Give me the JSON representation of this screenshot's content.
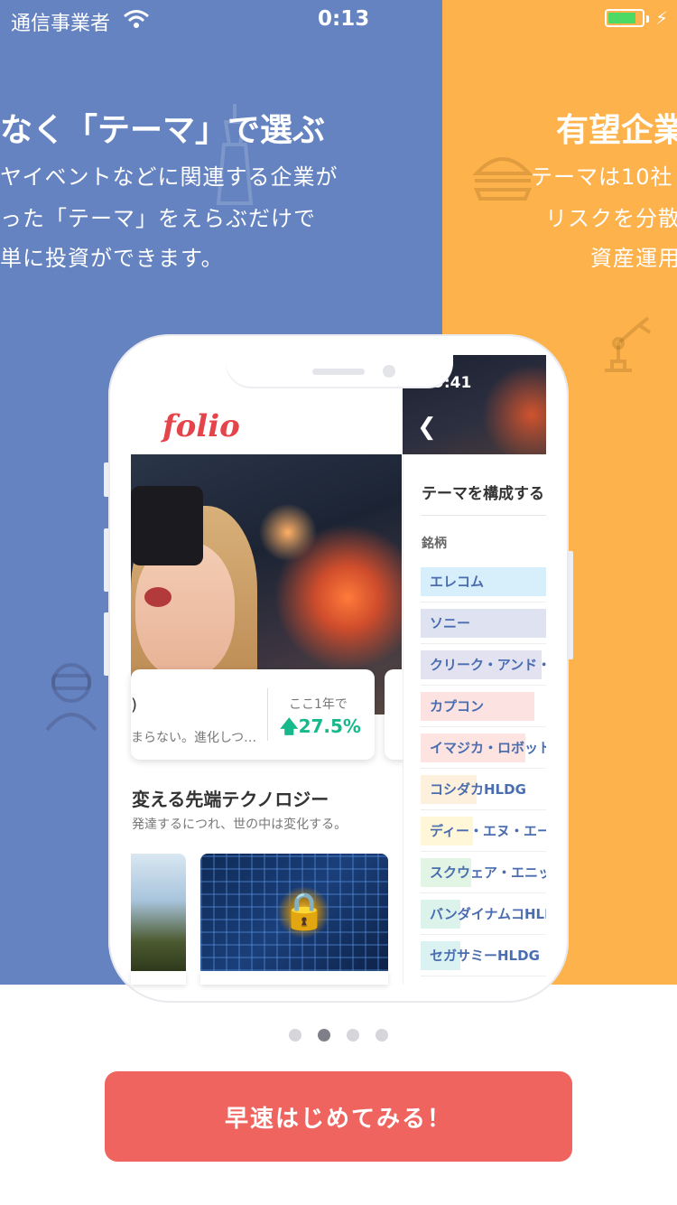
{
  "status_bar": {
    "carrier": "通信事業者",
    "time": "0:13",
    "wifi_icon": "wifi-icon",
    "battery_icon": "battery-charging-icon"
  },
  "slides": {
    "blue": {
      "title": "なく「テーマ」で選ぶ",
      "lines": [
        "ヤイベントなどに関連する企業が",
        "った「テーマ」をえらぶだけで",
        "単に投資ができます。"
      ],
      "bg_color": "#6583c1"
    },
    "orange": {
      "title": "有望企業",
      "lines": [
        "テーマは10社",
        "リスクを分散",
        "資産運用"
      ],
      "bg_color": "#fdb24c"
    }
  },
  "phone": {
    "left_screen": {
      "logo": "folio",
      "theme_card": {
        "title_fragment": ")",
        "subtitle_fragment": "まらない。進化しつ…",
        "perf_label": "ここ1年で",
        "perf_value": "27.5%"
      },
      "section_title": "変える先端テクノロジー",
      "section_subtitle": "発達するにつれ、世の中は変化する。"
    },
    "right_screen": {
      "time": "9:41",
      "title": "テーマを構成する",
      "label": "銘柄",
      "stocks": [
        {
          "name": "エレコム",
          "color": "#d7effa"
        },
        {
          "name": "ソニー",
          "color": "#dfe3f1"
        },
        {
          "name": "クリーク・アンド・",
          "color": "#e3e2f1"
        },
        {
          "name": "カプコン",
          "color": "#fde2e2"
        },
        {
          "name": "イマジカ・ロボット",
          "color": "#fde4e0"
        },
        {
          "name": "コシダカHLDG",
          "color": "#fdf0dc"
        },
        {
          "name": "ディー・エヌ・エー",
          "color": "#fff7d8"
        },
        {
          "name": "スクウェア・エニッ",
          "color": "#e2f4e4"
        },
        {
          "name": "バンダイナムコHLD",
          "color": "#dcf3ec"
        },
        {
          "name": "セガサミーHLDG",
          "color": "#dbf2f2"
        }
      ]
    }
  },
  "pager": {
    "count": 4,
    "active": 2
  },
  "cta": {
    "label": "早速はじめてみる！",
    "color": "#f06460"
  }
}
